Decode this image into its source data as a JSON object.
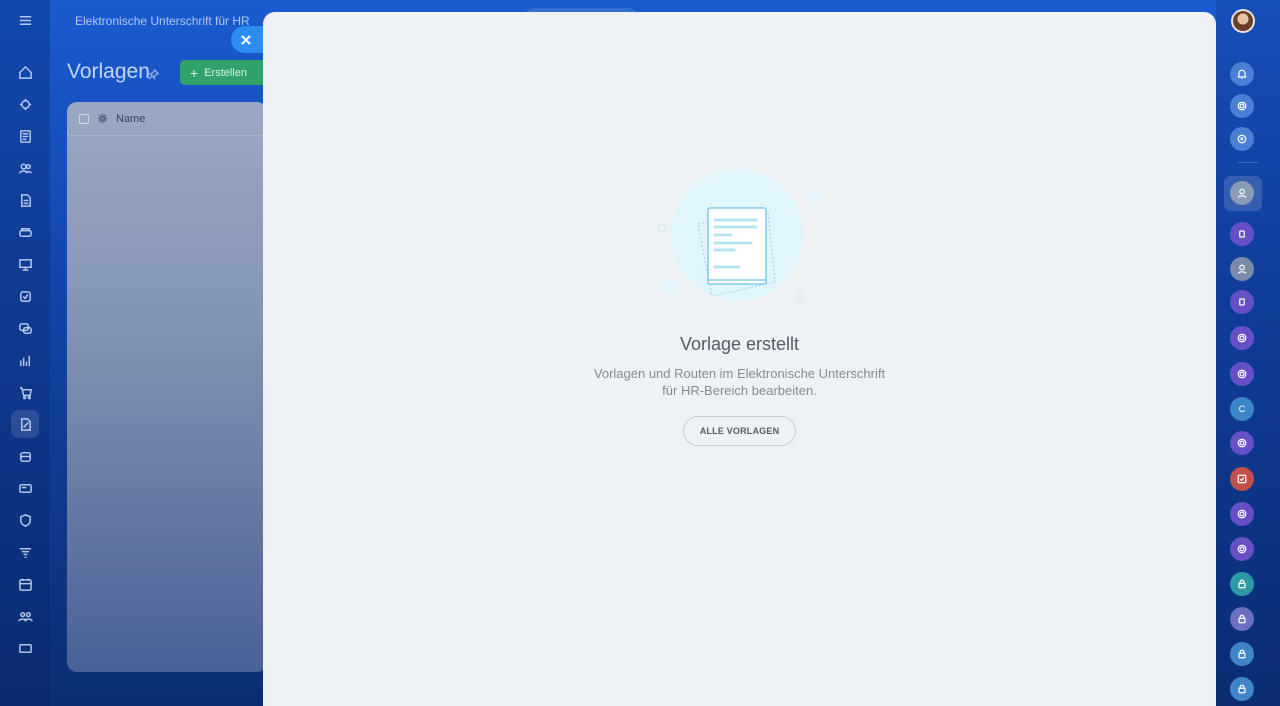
{
  "topbar": {
    "title": "Elektronische Unterschrift für HR"
  },
  "page": {
    "title": "Vorlagen"
  },
  "toolbar": {
    "create_label": "Erstellen"
  },
  "grid": {
    "header_name": "Name"
  },
  "left_rail": {
    "icons": [
      "menu-icon",
      "home-icon",
      "puzzle-icon",
      "newspaper-icon",
      "team-icon",
      "document-icon",
      "sofa-icon",
      "presentation-icon",
      "checkbox-icon",
      "chat-icon",
      "chart-icon",
      "cart-icon",
      "sign-icon",
      "stack-icon",
      "card-icon",
      "shield-icon",
      "funnel-icon",
      "calendar-icon",
      "people-icon",
      "grid-icon"
    ],
    "active": "sign-icon"
  },
  "right_rail": {
    "items": [
      {
        "type": "bell-icon",
        "color": "#4a7fd4"
      },
      {
        "type": "copilot-icon",
        "color": "#4a7fd4"
      },
      {
        "type": "chat-search-icon",
        "color": "#4a7fd4"
      },
      {
        "type": "avatar",
        "color": "#8a9bb8"
      },
      {
        "type": "app-icon",
        "color": "#6650c8"
      },
      {
        "type": "avatar",
        "color": "#7a8aa8"
      },
      {
        "type": "app-icon",
        "color": "#6650c8"
      },
      {
        "type": "copilot-icon",
        "color": "#6650c8"
      },
      {
        "type": "copilot-icon",
        "color": "#6650c8"
      },
      {
        "type": "letter",
        "label": "C",
        "color": "#3a86c8"
      },
      {
        "type": "copilot-icon",
        "color": "#6650c8"
      },
      {
        "type": "task-icon",
        "color": "#c0504d"
      },
      {
        "type": "copilot-icon",
        "color": "#6650c8"
      },
      {
        "type": "copilot-icon",
        "color": "#6650c8"
      },
      {
        "type": "lock-icon",
        "color": "#2e9aa8"
      },
      {
        "type": "lock-icon",
        "color": "#6a6fc0"
      },
      {
        "type": "lock-icon",
        "color": "#3f86c8"
      },
      {
        "type": "lock-icon",
        "color": "#3f86c8"
      }
    ]
  },
  "empty_state": {
    "title": "Vorlage erstellt",
    "description_line1": "Vorlagen und Routen im Elektronische Unterschrift",
    "description_line2": "für HR-Bereich bearbeiten.",
    "button_label": "ALLE VORLAGEN"
  },
  "colors": {
    "accent": "#2c8cf4",
    "create_button": "#2fa36a",
    "slider_bg": "#eef2f4",
    "title_text": "#525c69"
  }
}
